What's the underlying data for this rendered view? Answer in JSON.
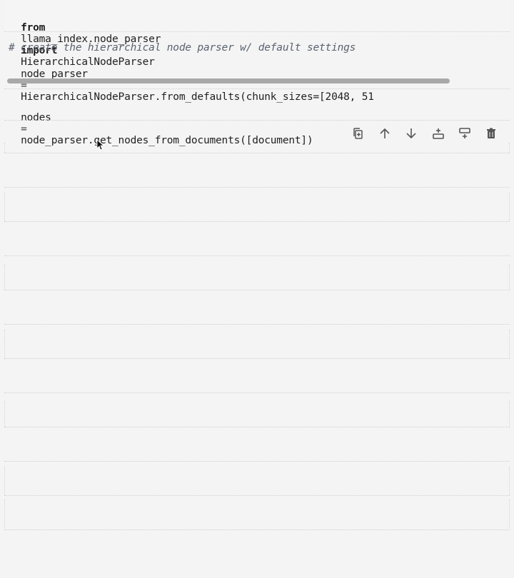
{
  "cells": [
    {
      "import_kw_from": "from",
      "import_module": "llama_index.node_parser",
      "import_kw_import": "import",
      "import_name": "HierarchicalNodeParser"
    },
    {
      "comment": "# create the hierarchical node parser w/ default settings",
      "assign_var": "node_parser",
      "assign_op": "=",
      "call": "HierarchicalNodeParser.from_defaults(chunk_sizes=[2048, 51"
    },
    {
      "var": "nodes",
      "op": "=",
      "call": "node_parser.get_nodes_from_documents([document])"
    }
  ],
  "toolbar": {
    "icons": [
      "duplicate-icon",
      "move-up-icon",
      "move-down-icon",
      "insert-above-icon",
      "insert-below-icon",
      "delete-icon"
    ]
  },
  "colors": {
    "background": "#f4f4f4",
    "scrollbar": "#a9a9a9",
    "icon": "#555555"
  }
}
